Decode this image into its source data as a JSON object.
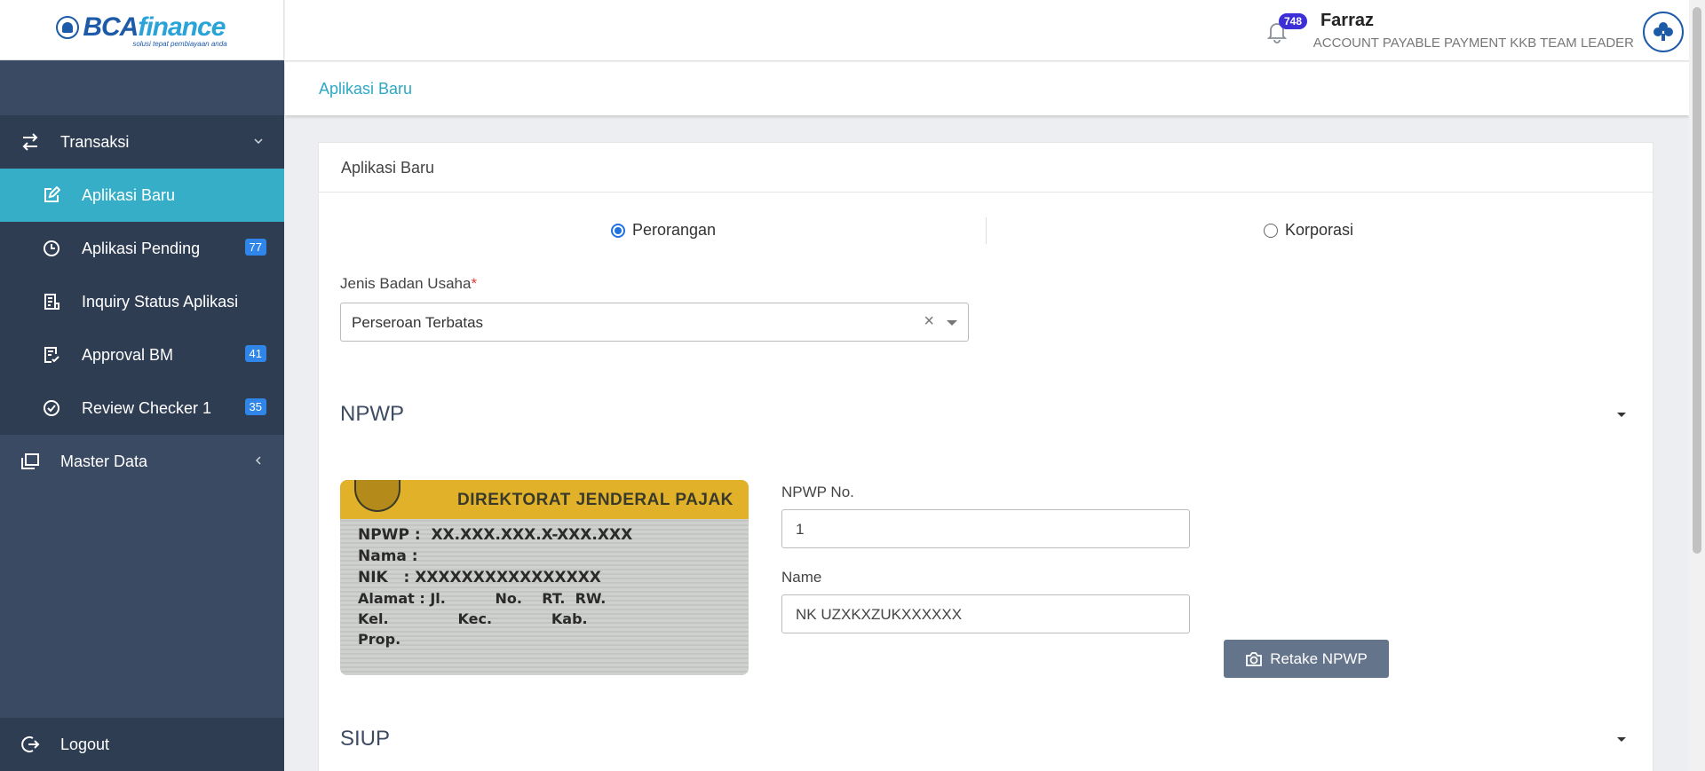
{
  "brand": {
    "name_part1": "BCA",
    "name_part2": "finance",
    "tagline": "solusi tepat pembiayaan anda"
  },
  "sidebar": {
    "groups": [
      {
        "label": "Transaksi",
        "icon": "exchange-icon",
        "expanded": true
      }
    ],
    "items": [
      {
        "label": "Aplikasi Baru",
        "icon": "edit-icon",
        "active": true
      },
      {
        "label": "Aplikasi Pending",
        "icon": "clock-icon",
        "badge": "77"
      },
      {
        "label": "Inquiry Status Aplikasi",
        "icon": "document-list-icon"
      },
      {
        "label": "Approval BM",
        "icon": "edit-check-icon",
        "badge": "41"
      },
      {
        "label": "Review Checker 1",
        "icon": "check-circle-icon",
        "badge": "35"
      }
    ],
    "master": {
      "label": "Master Data",
      "icon": "copy-icon"
    },
    "logout": {
      "label": "Logout",
      "icon": "logout-icon"
    }
  },
  "header": {
    "notification_count": "748",
    "user_name": "Farraz",
    "user_role": "ACCOUNT PAYABLE PAYMENT KKB TEAM LEADER"
  },
  "breadcrumb": {
    "current": "Aplikasi Baru"
  },
  "card": {
    "title": "Aplikasi Baru",
    "radio_options": [
      {
        "label": "Perorangan",
        "checked": true
      },
      {
        "label": "Korporasi",
        "checked": false
      }
    ],
    "jenis_badan_usaha": {
      "label": "Jenis Badan Usaha",
      "required_mark": "*",
      "value": "Perseroan Terbatas",
      "clear": "×"
    },
    "npwp_section": {
      "title": "NPWP",
      "image_lines": {
        "header": "DIREKTORAT JENDERAL PAJAK",
        "npwp": "NPWP :  XX.XXX.XXX.X-XXX.XXX",
        "nama": "Nama :",
        "nik": "NIK   : XXXXXXXXXXXXXXXX",
        "alamat": "Alamat : Jl.          No.    RT.  RW.",
        "kel": "Kel.              Kec.            Kab.",
        "prop": "Prop."
      },
      "npwp_no": {
        "label": "NPWP No.",
        "value": "1"
      },
      "name": {
        "label": "Name",
        "value": "NK UZXKXZUKXXXXXX"
      },
      "retake_button": "Retake NPWP"
    },
    "siup_section": {
      "title": "SIUP"
    }
  },
  "colors": {
    "sidebar_bg": "#3b4a63",
    "sidebar_active": "#37aec8",
    "badge_blue": "#2f86e8",
    "notif_badge": "#3c2fd6",
    "accent_link": "#2da8c4",
    "button": "#64748b"
  }
}
